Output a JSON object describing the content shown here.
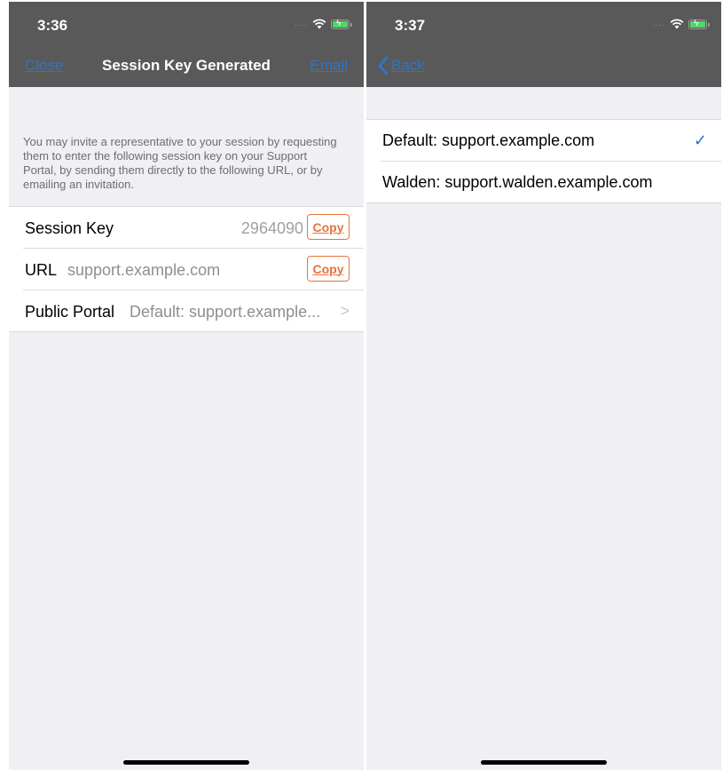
{
  "left": {
    "status_time": "3:36",
    "nav": {
      "close_label": "Close",
      "title": "Session Key Generated",
      "email_label": "Email"
    },
    "intro_text": "You may invite a representative to your session by requesting them to enter the following session key on your Support Portal, by sending them directly to the following URL, or by emailing an invitation.",
    "rows": {
      "session_key": {
        "label": "Session Key",
        "value": "2964090",
        "copy_label": "Copy"
      },
      "url": {
        "label": "URL",
        "value": "support.example.com",
        "copy_label": "Copy"
      },
      "portal": {
        "label": "Public Portal",
        "value": "Default: support.example..."
      }
    }
  },
  "right": {
    "status_time": "3:37",
    "nav": {
      "back_label": "Back"
    },
    "portal_options": [
      {
        "label": "Default: support.example.com",
        "selected": true
      },
      {
        "label": "Walden: support.walden.example.com",
        "selected": false
      }
    ]
  },
  "colors": {
    "nav_bg": "#595959",
    "link": "#2f74c9",
    "accent": "#e8733c",
    "background": "#efeff4"
  },
  "icons": [
    "wifi-icon",
    "battery-icon",
    "chevron-right-icon",
    "checkmark-icon",
    "back-chevron-icon"
  ]
}
